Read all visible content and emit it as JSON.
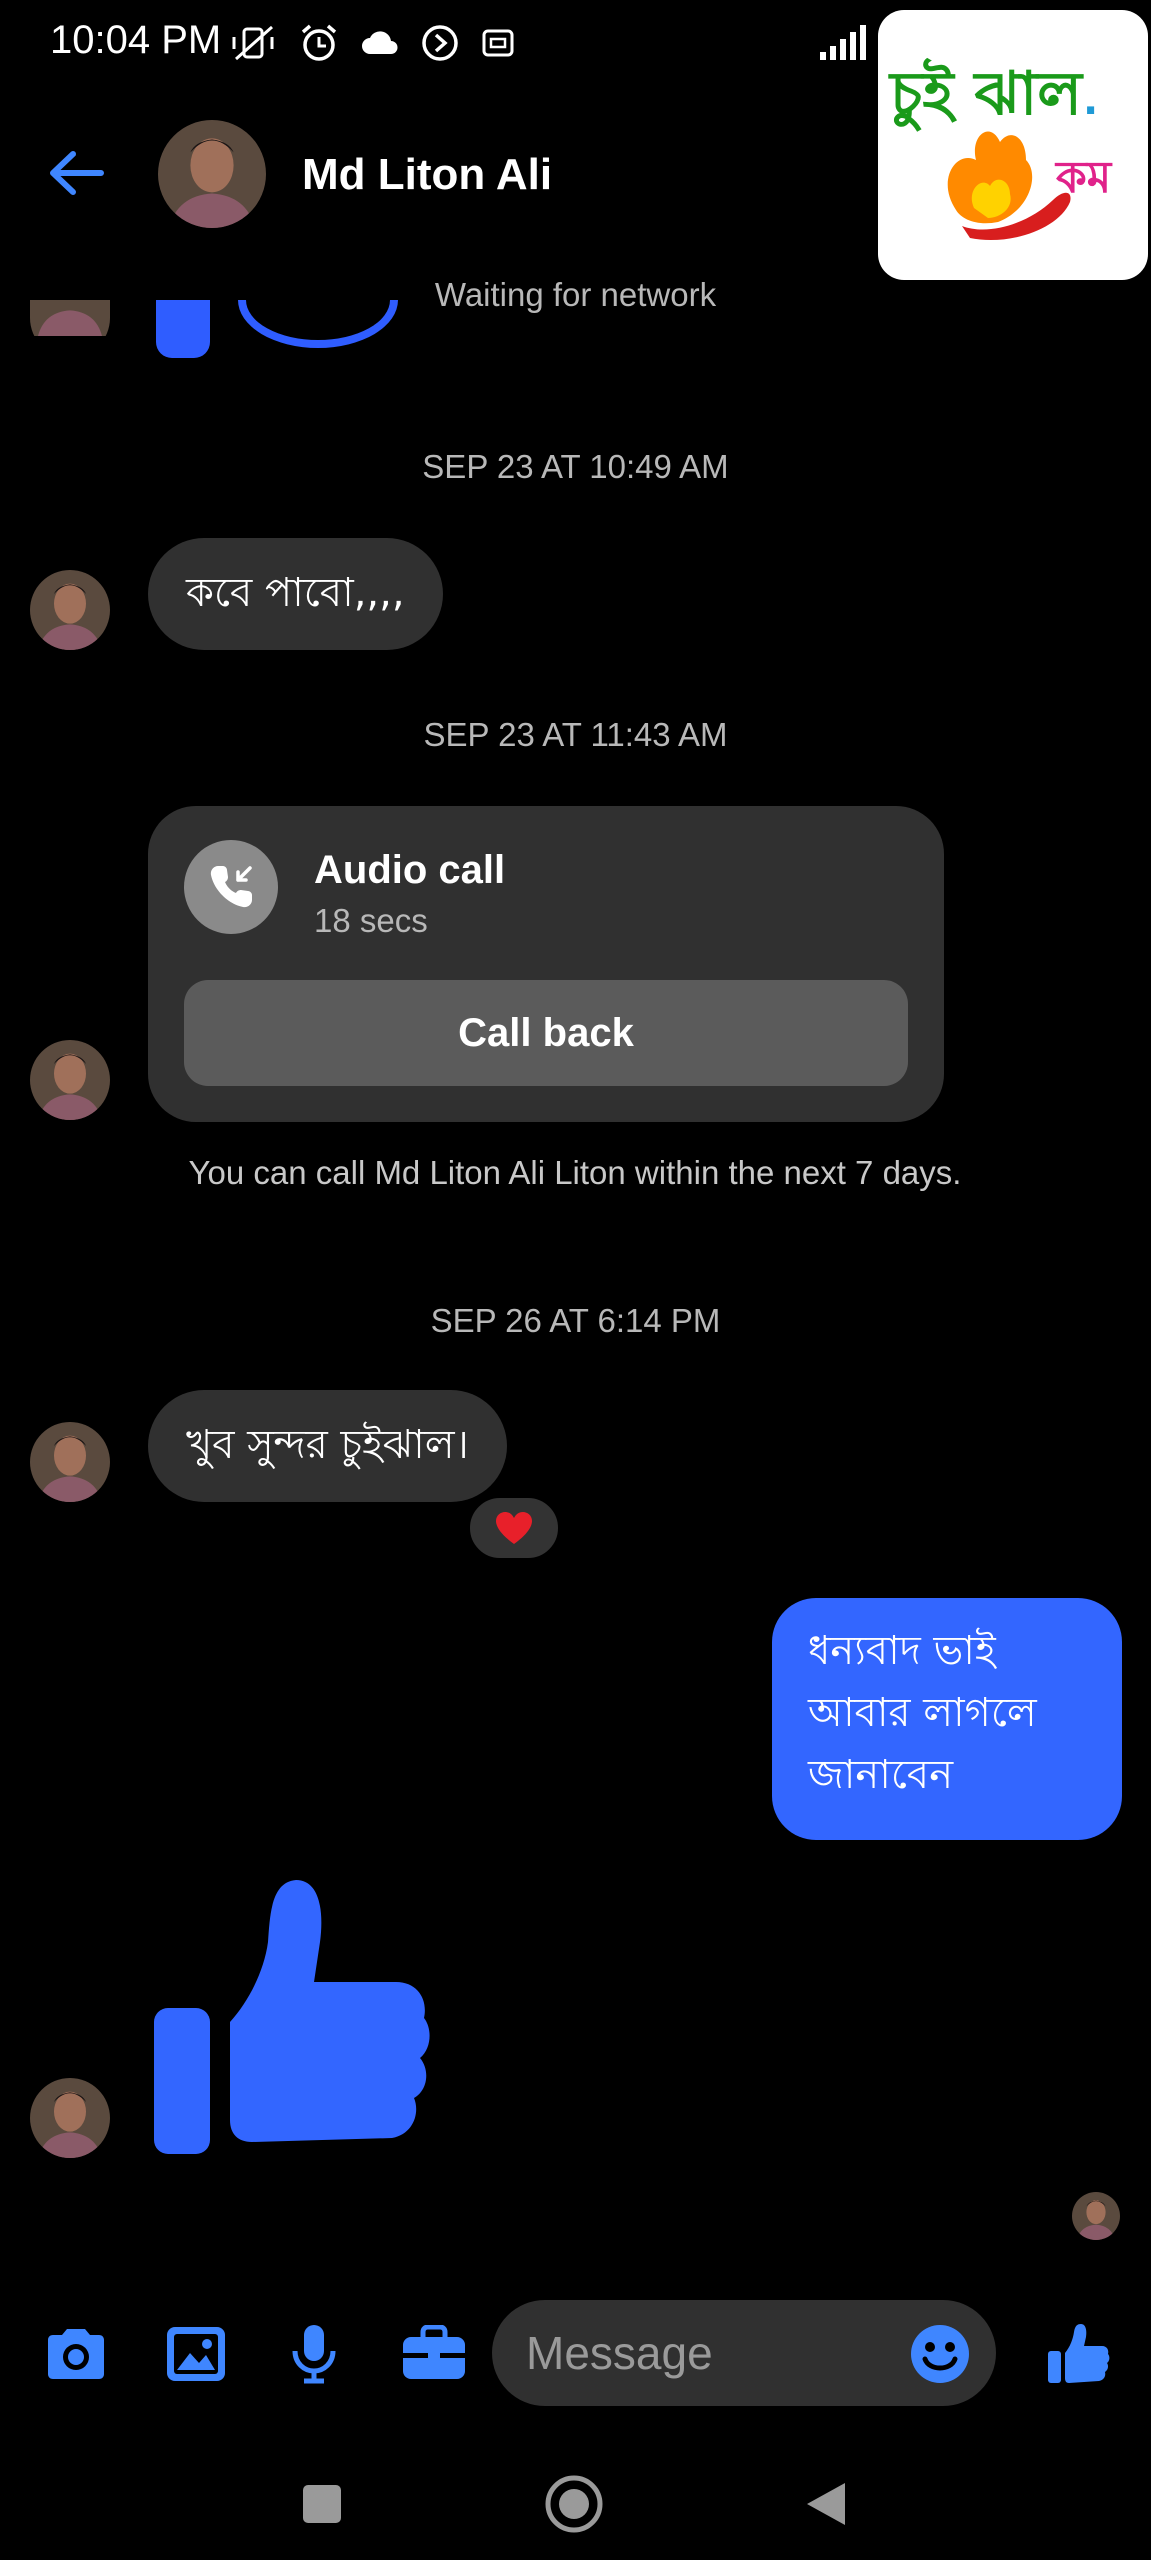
{
  "status_bar": {
    "time": "10:04 PM"
  },
  "logo": {
    "line1": "চুই ঝাল",
    "line2": "কম"
  },
  "header": {
    "contact_name": "Md Liton Ali"
  },
  "network_status": "Waiting for network",
  "messages": {
    "ts1": "SEP 23 AT 10:49 AM",
    "msg1": "কবে পাবো,,,,",
    "ts2": "SEP 23 AT 11:43 AM",
    "call": {
      "title": "Audio call",
      "duration": "18 secs",
      "button": "Call back",
      "note": "You can call Md Liton Ali Liton within the next 7 days."
    },
    "ts3": "SEP 26 AT 6:14 PM",
    "msg2": "খুব সুন্দর চুইঝাল।",
    "msg2_reaction": "❤️",
    "msg3_lines": [
      "ধন্যবাদ ভাই",
      "আবার লাগলে",
      "জানাবেন"
    ]
  },
  "composer": {
    "placeholder": "Message"
  },
  "colors": {
    "accent": "#3366ff",
    "bubble_in": "#303030",
    "background": "#000000"
  }
}
